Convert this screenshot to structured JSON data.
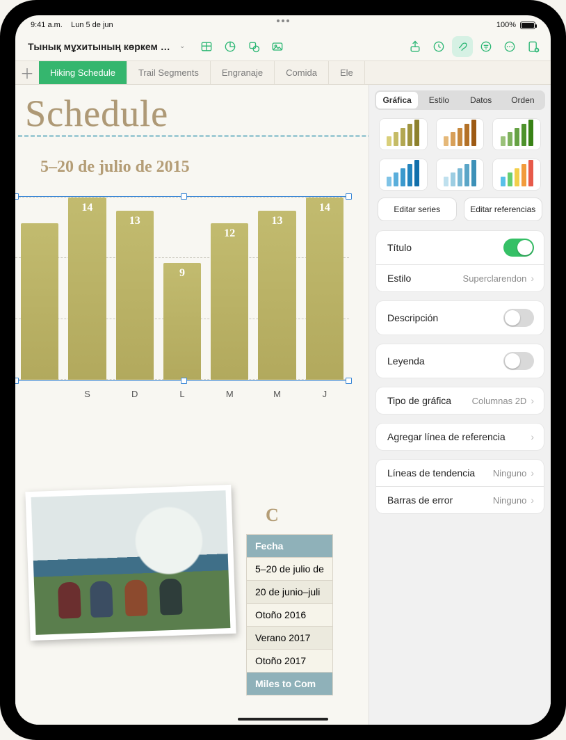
{
  "status": {
    "time": "9:41 a.m.",
    "date": "Lun 5 de jun",
    "battery": "100%"
  },
  "doc": {
    "title": "Тынық мұхитының көркем жолдары"
  },
  "toolbar_icons": [
    "table",
    "chart",
    "shape",
    "media",
    "share",
    "history",
    "format",
    "comments",
    "more",
    "collab"
  ],
  "sheet_tabs": [
    "Hiking Schedule",
    "Trail Segments",
    "Engranaje",
    "Comida",
    "Ele"
  ],
  "active_tab_index": 0,
  "canvas": {
    "big_title": "Schedule",
    "chart_title": "5–20 de julio de 2015",
    "section_title": "C"
  },
  "chart_data": {
    "type": "bar",
    "categories": [
      "",
      "S",
      "D",
      "L",
      "M",
      "M",
      "J"
    ],
    "values": [
      12,
      14,
      13,
      9,
      12,
      13,
      14
    ],
    "title": "5–20 de julio de 2015",
    "xlabel": "",
    "ylabel": "",
    "ylim": [
      0,
      14
    ],
    "value_labels_visible": [
      false,
      true,
      true,
      true,
      true,
      true,
      true
    ]
  },
  "table": {
    "header": "Fecha",
    "rows": [
      "5–20 de julio de",
      "20 de junio–juli",
      "Otoño 2016",
      "Verano 2017",
      "Otoño 2017"
    ],
    "footer": "Miles to Com"
  },
  "panel": {
    "segments": [
      "Gráfica",
      "Estilo",
      "Datos",
      "Orden"
    ],
    "active_segment": 0,
    "edit_series": "Editar series",
    "edit_refs": "Editar referencias",
    "rows": {
      "titulo": "Título",
      "estilo": "Estilo",
      "estilo_val": "Superclarendon",
      "descripcion": "Descripción",
      "leyenda": "Leyenda",
      "tipo": "Tipo de gráfica",
      "tipo_val": "Columnas 2D",
      "agregar": "Agregar línea de referencia",
      "tendencia": "Líneas de tendencia",
      "tendencia_val": "Ninguno",
      "error": "Barras de error",
      "error_val": "Ninguno"
    },
    "toggles": {
      "titulo": true,
      "descripcion": false,
      "leyenda": false
    }
  },
  "style_thumbs": [
    [
      "#d9cf7a",
      "#c5bb66",
      "#b2a752",
      "#9f943f",
      "#8d812d"
    ],
    [
      "#e5b879",
      "#d8a05a",
      "#c7893e",
      "#b37127",
      "#9d5a14"
    ],
    [
      "#9ac17a",
      "#7fb25e",
      "#66a244",
      "#4e922c",
      "#398216"
    ],
    [
      "#7fc3e6",
      "#5aaedb",
      "#3b99cd",
      "#2384bd",
      "#116fab"
    ],
    [
      "#bfe0ee",
      "#9ccde2",
      "#7ab9d5",
      "#5aa5c7",
      "#3d91b8"
    ],
    [
      "#58c0e8",
      "#69ce70",
      "#f2cf4b",
      "#f29b3c",
      "#e75a4a"
    ]
  ]
}
